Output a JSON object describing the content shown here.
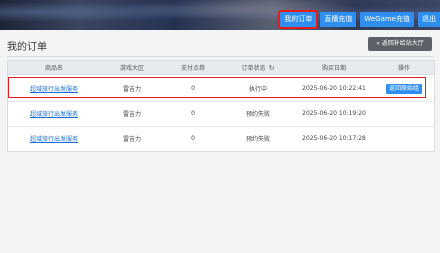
{
  "topnav": {
    "buttons": [
      {
        "label": "我的订单",
        "active": true
      },
      {
        "label": "直播充值",
        "active": false
      },
      {
        "label": "WeGame充值",
        "active": false
      },
      {
        "label": "退出",
        "active": false
      }
    ]
  },
  "page": {
    "title": "我的订单",
    "back_label": "« 返回补给站大厅"
  },
  "table": {
    "headers": [
      "商品名",
      "游戏大区",
      "支付点券",
      "订单状态",
      "购买日期",
      "操作"
    ],
    "refresh_icon": "refresh-icon",
    "rows": [
      {
        "product": "超域旅行出发服务",
        "region": "雷吉力",
        "paid": "0",
        "status": "执行中",
        "date": "2025-06-20 10:22:41",
        "action": "返回原始组"
      },
      {
        "product": "超域旅行出发服务",
        "region": "雷吉力",
        "paid": "0",
        "status": "预约失败",
        "date": "2025-06-20 10:19:20",
        "action": ""
      },
      {
        "product": "超域旅行出发服务",
        "region": "雷吉力",
        "paid": "0",
        "status": "预约失败",
        "date": "2025-06-20 10:17:28",
        "action": ""
      }
    ]
  },
  "colors": {
    "accent": "#2f8ff0",
    "highlight": "#e51c1c",
    "link": "#1a6fd6"
  }
}
